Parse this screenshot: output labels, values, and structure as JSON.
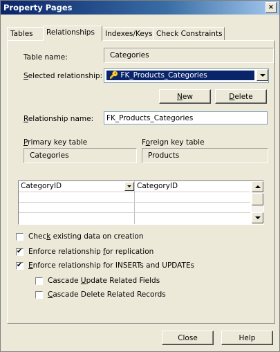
{
  "window": {
    "title": "Property Pages",
    "close_glyph": "×"
  },
  "tabs": [
    {
      "label": "Tables",
      "active": false
    },
    {
      "label": "Relationships",
      "active": true
    },
    {
      "label": "Indexes/Keys",
      "active": false
    },
    {
      "label": "Check Constraints",
      "active": false
    }
  ],
  "form": {
    "table_name_label": "Table name:",
    "table_name_value": "Categories",
    "selected_rel_label_pre": "",
    "selected_rel_label_u": "S",
    "selected_rel_label_post": "elected relationship:",
    "selected_rel_value": "FK_Products_Categories",
    "new_button_u": "N",
    "new_button_rest": "ew",
    "delete_button_u": "D",
    "delete_button_rest": "elete",
    "rel_name_label_u": "R",
    "rel_name_label_rest": "elationship name:",
    "rel_name_value": "FK_Products_Categories",
    "pk_label_u": "P",
    "pk_label_rest": "rimary key table",
    "pk_value": "Categories",
    "fk_label_pre": "F",
    "fk_label_u": "o",
    "fk_label_rest": "reign key table",
    "fk_value": "Products"
  },
  "grid": {
    "rows": [
      {
        "primary": "CategoryID",
        "foreign": "CategoryID"
      },
      {
        "primary": "",
        "foreign": ""
      },
      {
        "primary": "",
        "foreign": ""
      },
      {
        "primary": "",
        "foreign": ""
      }
    ]
  },
  "options": {
    "check_existing": {
      "pre": "Chec",
      "u": "k",
      "post": " existing data on creation",
      "checked": false
    },
    "enforce_replication": {
      "pre": "Enforce relationship ",
      "u": "f",
      "post": "or replication",
      "checked": true
    },
    "enforce_inserts": {
      "pre": "",
      "u": "E",
      "post": "nforce relationship for INSERTs and UPDATEs",
      "checked": true
    },
    "cascade_update": {
      "pre": "Cascade ",
      "u": "U",
      "post": "pdate Related Fields",
      "checked": false
    },
    "cascade_delete": {
      "pre": "",
      "u": "C",
      "post": "ascade Delete Related Records",
      "checked": false
    }
  },
  "footer": {
    "close_label": "Close",
    "help_label": "Help"
  }
}
